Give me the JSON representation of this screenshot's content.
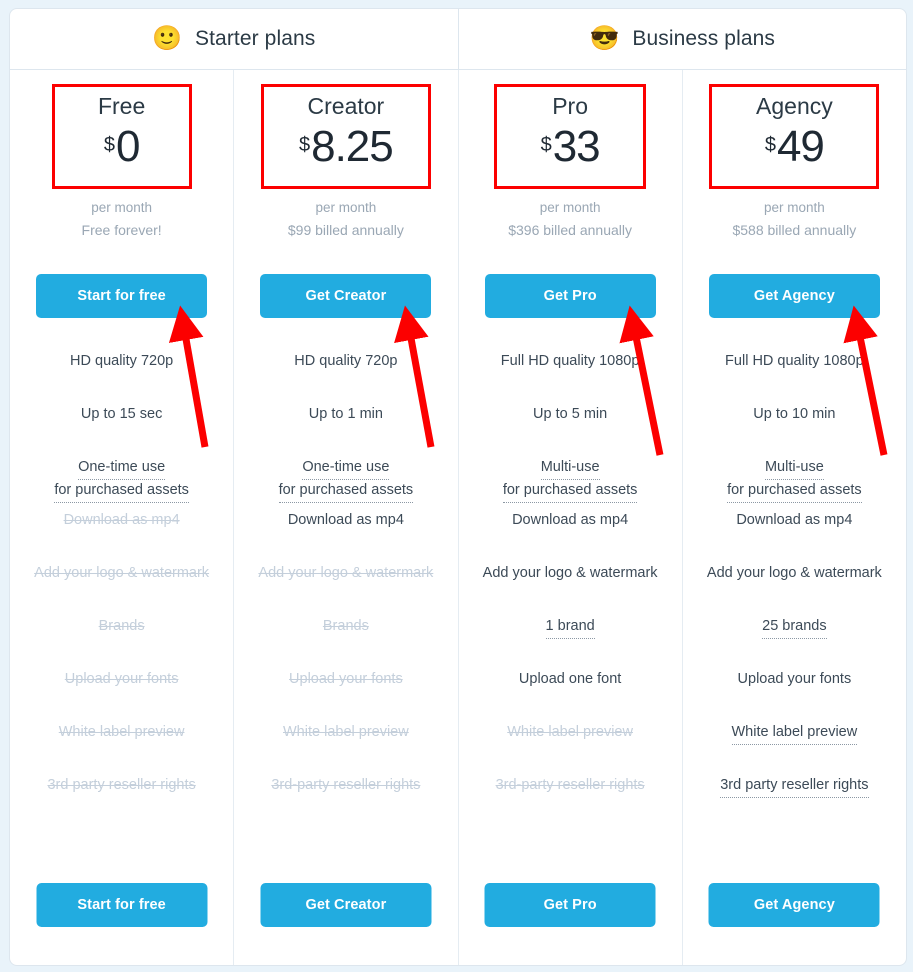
{
  "header": {
    "groups": [
      {
        "emoji": "🙂",
        "emoji_name": "slightly-smiling-face",
        "label": "Starter plans"
      },
      {
        "emoji": "😎",
        "emoji_name": "smiling-face-with-sunglasses",
        "label": "Business plans"
      }
    ]
  },
  "colors": {
    "accent": "#22ace0",
    "annotation": "#fc0000",
    "page_background": "#e9f3fa",
    "text": "#3c4a57",
    "muted": "#9aa7b4",
    "disabled": "#c4cfdb"
  },
  "plans": [
    {
      "name": "Free",
      "currency": "$",
      "amount": "0",
      "per_month": "per month",
      "billing_note": "Free forever!",
      "cta": "Start for free",
      "features": [
        {
          "lines": [
            "HD quality 720p"
          ],
          "enabled": true,
          "dotted": false
        },
        {
          "lines": [
            "Up to 15 sec"
          ],
          "enabled": true,
          "dotted": false
        },
        {
          "lines": [
            "One-time use",
            "for purchased assets"
          ],
          "enabled": true,
          "dotted": true
        },
        {
          "lines": [
            "Download as mp4"
          ],
          "enabled": false,
          "dotted": false
        },
        {
          "lines": [
            "Add your logo & watermark"
          ],
          "enabled": false,
          "dotted": false
        },
        {
          "lines": [
            "Brands"
          ],
          "enabled": false,
          "dotted": false
        },
        {
          "lines": [
            "Upload your fonts"
          ],
          "enabled": false,
          "dotted": false
        },
        {
          "lines": [
            "White label preview"
          ],
          "enabled": false,
          "dotted": false
        },
        {
          "lines": [
            "3rd party reseller rights"
          ],
          "enabled": false,
          "dotted": false
        }
      ]
    },
    {
      "name": "Creator",
      "currency": "$",
      "amount": "8.25",
      "per_month": "per month",
      "billing_note": "$99 billed annually",
      "cta": "Get Creator",
      "features": [
        {
          "lines": [
            "HD quality 720p"
          ],
          "enabled": true,
          "dotted": false
        },
        {
          "lines": [
            "Up to 1 min"
          ],
          "enabled": true,
          "dotted": false
        },
        {
          "lines": [
            "One-time use",
            "for purchased assets"
          ],
          "enabled": true,
          "dotted": true
        },
        {
          "lines": [
            "Download as mp4"
          ],
          "enabled": true,
          "dotted": false
        },
        {
          "lines": [
            "Add your logo & watermark"
          ],
          "enabled": false,
          "dotted": false
        },
        {
          "lines": [
            "Brands"
          ],
          "enabled": false,
          "dotted": false
        },
        {
          "lines": [
            "Upload your fonts"
          ],
          "enabled": false,
          "dotted": false
        },
        {
          "lines": [
            "White label preview"
          ],
          "enabled": false,
          "dotted": false
        },
        {
          "lines": [
            "3rd-party reseller rights"
          ],
          "enabled": false,
          "dotted": false
        }
      ]
    },
    {
      "name": "Pro",
      "currency": "$",
      "amount": "33",
      "per_month": "per month",
      "billing_note": "$396 billed annually",
      "cta": "Get Pro",
      "features": [
        {
          "lines": [
            "Full HD quality 1080p"
          ],
          "enabled": true,
          "dotted": false
        },
        {
          "lines": [
            "Up to 5 min"
          ],
          "enabled": true,
          "dotted": false
        },
        {
          "lines": [
            "Multi-use",
            "for purchased assets"
          ],
          "enabled": true,
          "dotted": true
        },
        {
          "lines": [
            "Download as mp4"
          ],
          "enabled": true,
          "dotted": false
        },
        {
          "lines": [
            "Add your logo & watermark"
          ],
          "enabled": true,
          "dotted": false
        },
        {
          "lines": [
            "1 brand"
          ],
          "enabled": true,
          "dotted": true
        },
        {
          "lines": [
            "Upload one font"
          ],
          "enabled": true,
          "dotted": false
        },
        {
          "lines": [
            "White label preview"
          ],
          "enabled": false,
          "dotted": false
        },
        {
          "lines": [
            "3rd-party reseller rights"
          ],
          "enabled": false,
          "dotted": false
        }
      ]
    },
    {
      "name": "Agency",
      "currency": "$",
      "amount": "49",
      "per_month": "per month",
      "billing_note": "$588 billed annually",
      "cta": "Get Agency",
      "features": [
        {
          "lines": [
            "Full HD quality 1080p"
          ],
          "enabled": true,
          "dotted": false
        },
        {
          "lines": [
            "Up to 10 min"
          ],
          "enabled": true,
          "dotted": false
        },
        {
          "lines": [
            "Multi-use",
            "for purchased assets"
          ],
          "enabled": true,
          "dotted": true
        },
        {
          "lines": [
            "Download as mp4"
          ],
          "enabled": true,
          "dotted": false
        },
        {
          "lines": [
            "Add your logo & watermark"
          ],
          "enabled": true,
          "dotted": false
        },
        {
          "lines": [
            "25 brands"
          ],
          "enabled": true,
          "dotted": true
        },
        {
          "lines": [
            "Upload your fonts"
          ],
          "enabled": true,
          "dotted": false
        },
        {
          "lines": [
            "White label preview"
          ],
          "enabled": true,
          "dotted": true
        },
        {
          "lines": [
            "3rd party reseller rights"
          ],
          "enabled": true,
          "dotted": true
        }
      ]
    }
  ],
  "annotations": {
    "highlight_boxes": 4,
    "arrows": 4,
    "arrow_target": "cta-button"
  }
}
